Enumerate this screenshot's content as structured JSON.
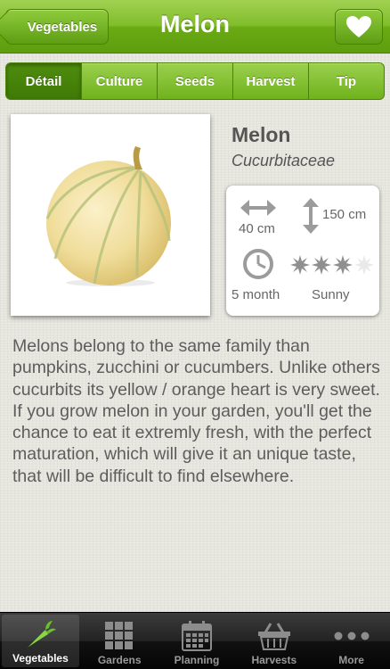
{
  "nav": {
    "back_label": "Vegetables",
    "title": "Melon"
  },
  "tabs": [
    {
      "label": "Détail",
      "active": true
    },
    {
      "label": "Culture",
      "active": false
    },
    {
      "label": "Seeds",
      "active": false
    },
    {
      "label": "Harvest",
      "active": false
    },
    {
      "label": "Tip",
      "active": false
    }
  ],
  "plant": {
    "name": "Melon",
    "family": "Cucurbitaceae",
    "spacing": "40 cm",
    "height": "150 cm",
    "duration": "5 month",
    "sun": "Sunny",
    "sun_level": {
      "filled": 3,
      "total": 4
    }
  },
  "description": "Melons belong to the same family than pumpkins, zucchini or cucumbers. Unlike others cucurbits its yellow / orange heart is very sweet.\nIf you grow melon in your garden, you'll get the chance to eat it extremly fresh, with the perfect maturation, which will give it an unique taste, that will be difficult to find elsewhere.",
  "tabbar": [
    {
      "label": "Vegetables",
      "icon": "carrot-icon",
      "active": true
    },
    {
      "label": "Gardens",
      "icon": "grid-icon",
      "active": false
    },
    {
      "label": "Planning",
      "icon": "calendar-icon",
      "active": false
    },
    {
      "label": "Harvests",
      "icon": "basket-icon",
      "active": false
    },
    {
      "label": "More",
      "icon": "more-icon",
      "active": false
    }
  ],
  "colors": {
    "accent": "#6aab14",
    "tab_active": "#3f7a06",
    "text": "#5d5d5d"
  }
}
